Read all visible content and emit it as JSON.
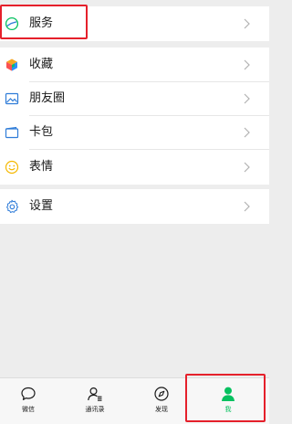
{
  "menu": {
    "services": {
      "label": "服务",
      "icon": "services-icon"
    },
    "favorites": {
      "label": "收藏",
      "icon": "favorites-cube-icon"
    },
    "moments": {
      "label": "朋友圈",
      "icon": "moments-picture-icon"
    },
    "cards": {
      "label": "卡包",
      "icon": "card-wallet-icon"
    },
    "stickers": {
      "label": "表情",
      "icon": "sticker-smiley-icon"
    },
    "settings": {
      "label": "设置",
      "icon": "settings-gear-icon"
    }
  },
  "tabbar": {
    "chats": {
      "label": "微信",
      "icon": "chat-bubble-icon"
    },
    "contacts": {
      "label": "通讯录",
      "icon": "contacts-icon"
    },
    "discover": {
      "label": "发现",
      "icon": "compass-icon"
    },
    "me": {
      "label": "我",
      "icon": "person-icon",
      "active": true
    }
  },
  "colors": {
    "accent_green": "#07c160",
    "highlight_red": "#e5202b",
    "background": "#ededed",
    "favorites_orange": "#f6a623",
    "favorites_red": "#fa5151",
    "favorites_blue": "#2b90ff",
    "favorites_green": "#07c160",
    "icon_blue": "#2f7cd8",
    "sticker_yellow": "#f5b800"
  }
}
